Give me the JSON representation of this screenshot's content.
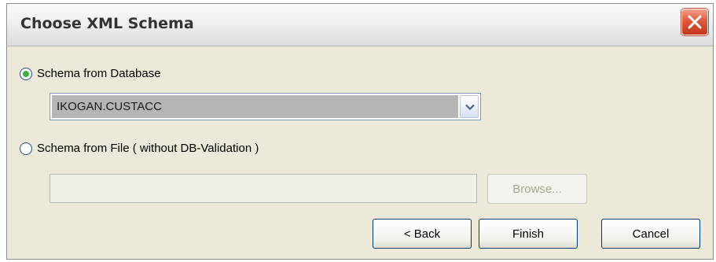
{
  "window": {
    "title": "Choose XML Schema"
  },
  "options": {
    "database_label": "Schema from Database",
    "database_selected": true,
    "file_label": "Schema from File ( without DB-Validation )",
    "file_selected": false
  },
  "schema_combo": {
    "value": "IKOGAN.CUSTACC"
  },
  "file_input": {
    "value": ""
  },
  "buttons": {
    "browse": "Browse...",
    "back": "< Back",
    "finish": "Finish",
    "cancel": "Cancel"
  },
  "icons": {
    "close": "close-icon",
    "dropdown": "chevron-down-icon"
  },
  "colors": {
    "close_red": "#d9502f",
    "radio_green": "#3bb13b",
    "dialog_bg": "#ece9d8"
  }
}
